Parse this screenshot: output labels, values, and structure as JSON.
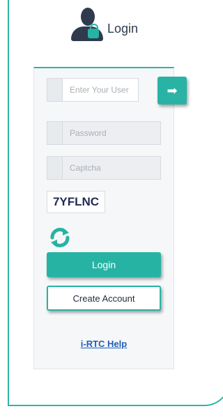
{
  "header": {
    "title": "Login",
    "icon": "user-lock-icon"
  },
  "form": {
    "username_placeholder": "Enter Your User",
    "password_placeholder": "Password",
    "captcha_placeholder": "Captcha",
    "captcha_text": "7YFLNC",
    "go_icon": "arrow-right-icon",
    "refresh_icon": "refresh-icon"
  },
  "buttons": {
    "login_label": "Login",
    "create_account_label": "Create Account"
  },
  "links": {
    "help_label": "i-RTC Help"
  },
  "colors": {
    "accent": "#27b3a4",
    "dark": "#2f3b4d",
    "link": "#1e5fb8"
  }
}
